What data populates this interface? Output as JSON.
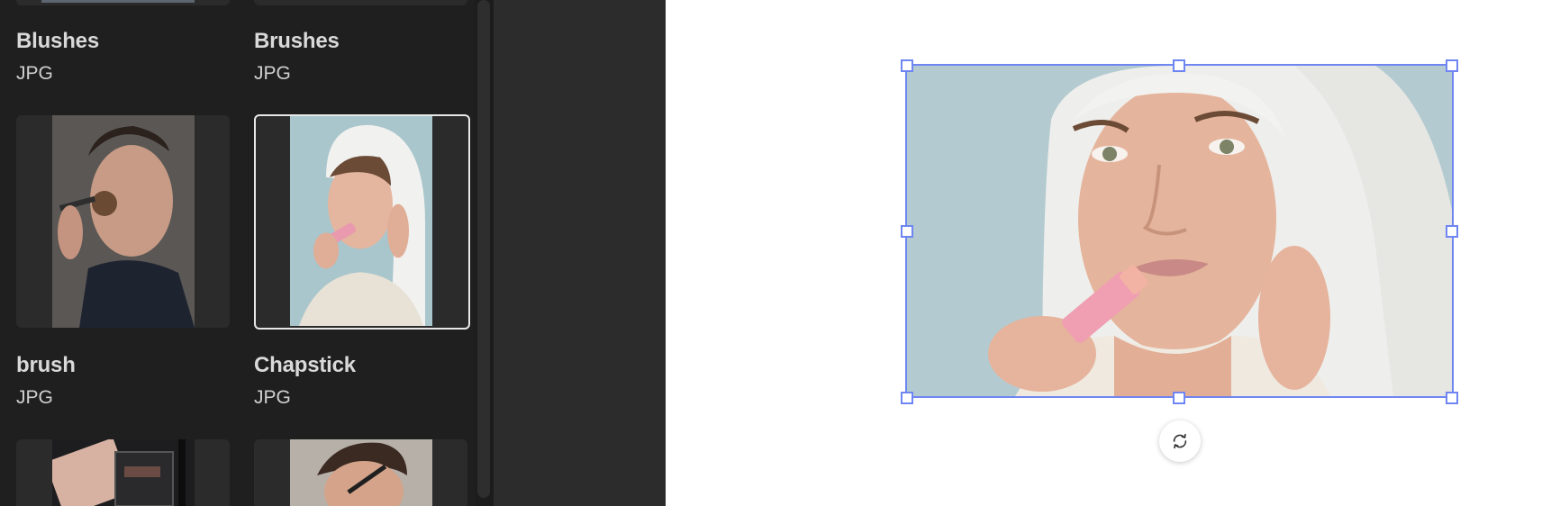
{
  "library": {
    "items": [
      {
        "name": "Blushes",
        "type": "JPG",
        "thumb_icon": "photo-thumbnail-icon"
      },
      {
        "name": "Brushes",
        "type": "JPG",
        "thumb_icon": "photo-thumbnail-icon"
      },
      {
        "name": "brush",
        "type": "JPG",
        "thumb_icon": "photo-thumbnail-icon"
      },
      {
        "name": "Chapstick",
        "type": "JPG",
        "thumb_icon": "photo-thumbnail-icon",
        "selected": true
      }
    ]
  },
  "canvas": {
    "selected_image": "Chapstick",
    "selection_color": "#6f86f2",
    "rotate_icon": "rotate-icon"
  },
  "colors": {
    "panel_bg": "#1f1f1f",
    "tile_bg": "#2b2b2b",
    "stage_bg": "#ffffff"
  }
}
